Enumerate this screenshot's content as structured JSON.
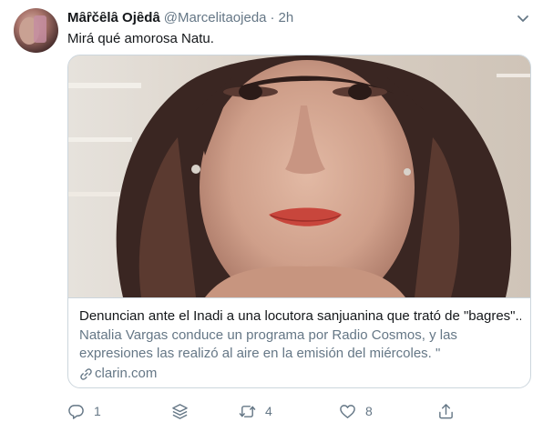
{
  "tweet": {
    "display_name": "Mȃȓčȇlȃ Ojȇdȃ",
    "handle": "@Marcelitaojeda",
    "separator": "·",
    "time": "2h",
    "text": "Mirá qué amorosa Natu."
  },
  "card": {
    "title": "Denuncian ante el Inadi a una locutora sanjuanina que trató de \"bagres\"...",
    "description": "Natalia Vargas conduce un programa por Radio Cosmos, y las expresiones las realizó al aire en la emisión del miércoles. \"",
    "domain": "clarin.com"
  },
  "actions": {
    "reply_count": "1",
    "retweet_count": "4",
    "like_count": "8"
  },
  "icons": {
    "chevron": "chevron-down-icon",
    "reply": "reply-icon",
    "stack": "stack-icon",
    "retweet": "retweet-icon",
    "like": "heart-icon",
    "share": "share-icon",
    "link": "link-icon"
  },
  "colors": {
    "text": "#14171a",
    "muted": "#657786",
    "border": "#ccd6dd"
  }
}
